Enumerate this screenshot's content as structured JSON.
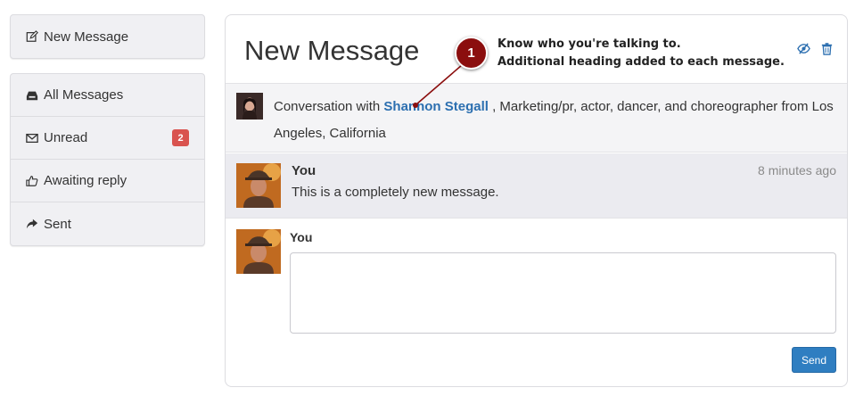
{
  "sidebar": {
    "compose": {
      "label": "New Message",
      "icon": "edit-icon"
    },
    "items": [
      {
        "label": "All Messages",
        "icon": "inbox-icon"
      },
      {
        "label": "Unread",
        "icon": "envelope-icon",
        "badge": "2"
      },
      {
        "label": "Awaiting reply",
        "icon": "thumbs-up-icon"
      },
      {
        "label": "Sent",
        "icon": "share-arrow-icon"
      }
    ]
  },
  "panel": {
    "title": "New Message",
    "header_icons": [
      "eye-slash-icon",
      "trash-icon"
    ]
  },
  "conversation": {
    "prefix": "Conversation with",
    "name": "Shannon Stegall",
    "description": ", Marketing/pr, actor, dancer, and choreographer from Los Angeles, California"
  },
  "message": {
    "author": "You",
    "time": "8 minutes ago",
    "body": "This is a completely new message."
  },
  "reply": {
    "author": "You",
    "placeholder": "",
    "send_label": "Send"
  },
  "annotation": {
    "number": "1",
    "line1": "Know who you're talking to.",
    "line2": "Additional heading added to each message."
  },
  "colors": {
    "link": "#2c6fb0",
    "badge": "#d9534f",
    "send_button": "#2f7ec1",
    "callout": "#8b0e0e"
  }
}
